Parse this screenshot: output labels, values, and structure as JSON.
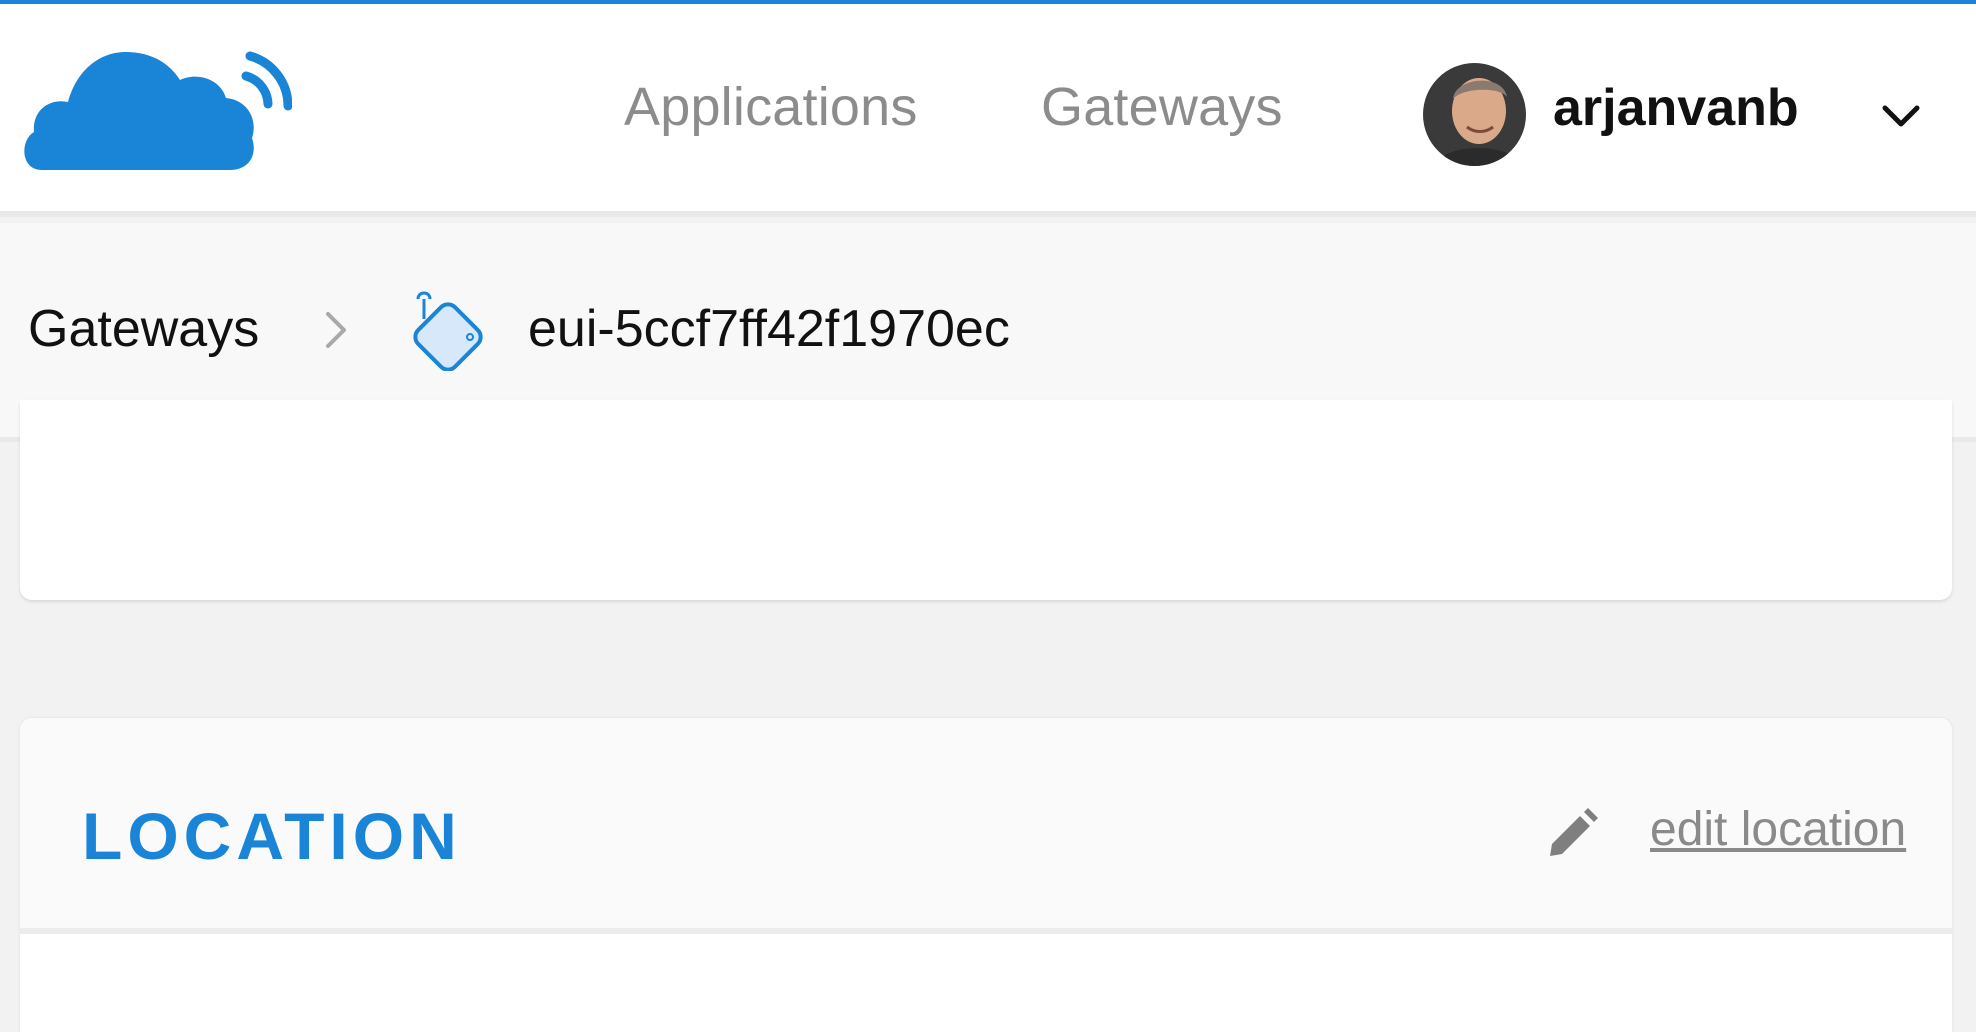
{
  "header": {
    "nav": {
      "applications": "Applications",
      "gateways": "Gateways"
    },
    "user": {
      "username": "arjanvanb"
    }
  },
  "breadcrumb": {
    "root": "Gateways",
    "current": "eui-5ccf7ff42f1970ec"
  },
  "location_card": {
    "title": "LOCATION",
    "edit_label": "edit location"
  },
  "colors": {
    "accent": "#1a85d6",
    "nav_text": "#8c8c8c",
    "link_text": "#8a8a8a",
    "background": "#f2f2f2"
  },
  "icons": [
    "ttn-cloud-logo",
    "avatar",
    "chevron-down-icon",
    "chevron-right-icon",
    "gateway-icon",
    "pencil-icon"
  ]
}
